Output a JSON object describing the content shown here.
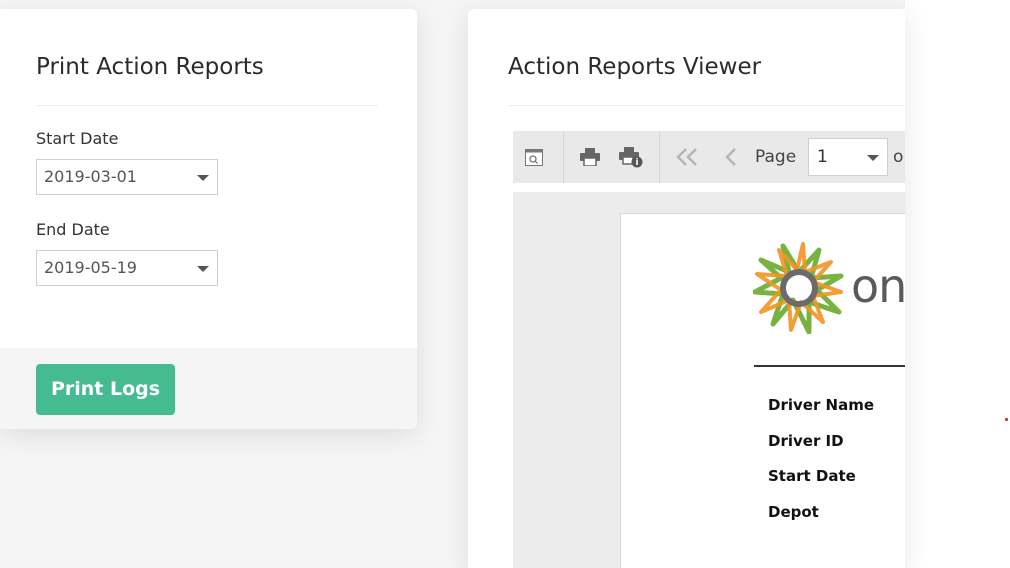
{
  "left_panel": {
    "title": "Print Action Reports",
    "start_date_label": "Start Date",
    "start_date_value": "2019-03-01",
    "end_date_label": "End Date",
    "end_date_value": "2019-05-19",
    "print_button_label": "Print Logs",
    "button_color": "#44bb91"
  },
  "viewer": {
    "title": "Action Reports Viewer",
    "toolbar": {
      "page_label": "Page",
      "page_value": "1",
      "page_of_fragment": "o",
      "icons": [
        "toggle-sidebar-icon",
        "print-icon",
        "print-info-icon",
        "first-page-icon",
        "previous-page-icon"
      ]
    },
    "report": {
      "logo_text_fragment": "on",
      "logo_colors": {
        "green": "#78b342",
        "orange": "#f29522",
        "gray": "#6b6b6b"
      },
      "fields": [
        "Driver Name",
        "Driver ID",
        "Start Date",
        "Depot"
      ]
    }
  }
}
